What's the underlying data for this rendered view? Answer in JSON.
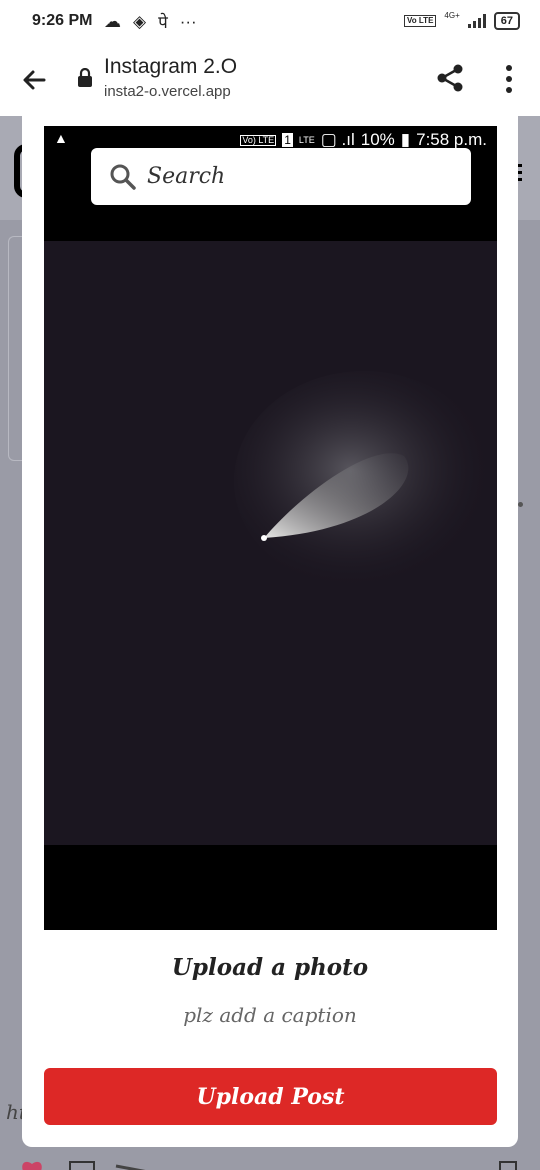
{
  "status_bar": {
    "time": "9:26 PM",
    "network": "4G+",
    "battery": "67",
    "volte": "Vo LTE"
  },
  "browser": {
    "title": "Instagram 2.O",
    "url": "insta2-o.vercel.app"
  },
  "background": {
    "footer_text": "ht"
  },
  "search": {
    "placeholder": "Search"
  },
  "photo_status_bar": {
    "volte": "Vo) LTE",
    "sim": "1",
    "lte": "LTE",
    "battery": "10%",
    "time": "7:58 p.m."
  },
  "modal": {
    "heading": "Upload a photo",
    "caption_placeholder": "plz add a caption",
    "upload_button": "Upload Post"
  },
  "colors": {
    "accent": "#dd2826",
    "overlay": "#9a9ba6",
    "photo_sky": "#1b1620"
  }
}
